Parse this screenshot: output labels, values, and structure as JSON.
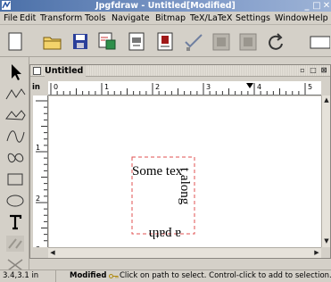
{
  "window": {
    "title": "Jpgfdraw - Untitled[Modified]",
    "controls": [
      "_",
      "□",
      "✕"
    ]
  },
  "menubar": [
    {
      "label": "File"
    },
    {
      "label": "Edit"
    },
    {
      "label": "Transform"
    },
    {
      "label": "Tools"
    },
    {
      "label": "Navigate"
    },
    {
      "label": "Bitmap"
    },
    {
      "label": "TeX/LaTeX"
    },
    {
      "label": "Settings"
    },
    {
      "label": "Window"
    },
    {
      "label": "Help"
    }
  ],
  "toolbar": [
    "new-file-icon",
    "open-folder-icon",
    "save-icon",
    "image-properties-icon",
    "export-icon",
    "page-icon",
    "check-icon",
    "gray-button-icon",
    "gray-button-icon",
    "redo-icon",
    "window-icon"
  ],
  "tools": [
    "select-pointer-icon",
    "open-line-icon",
    "closed-line-icon",
    "open-curve-icon",
    "closed-curve-icon",
    "rectangle-icon",
    "ellipse-icon",
    "text-icon",
    "math-icon",
    "gray-tool-icon"
  ],
  "document": {
    "title": "Untitled",
    "unit": "in",
    "ruler_labels": [
      "0",
      "1",
      "2",
      "3",
      "4",
      "5"
    ],
    "vruler_labels": [
      "1",
      "2",
      "3"
    ],
    "text_on_path": {
      "line1": "Some tex",
      "line2": "t along",
      "line3": "a path"
    }
  },
  "status": {
    "position": "3.4,3.1 in",
    "modified": "Modified",
    "hint": "Click on path to select. Control-click to add to selection. Doub"
  },
  "colors": {
    "titlebar": "#4b70a8",
    "selection_box": "#e05050",
    "chrome": "#d4d0c8"
  }
}
